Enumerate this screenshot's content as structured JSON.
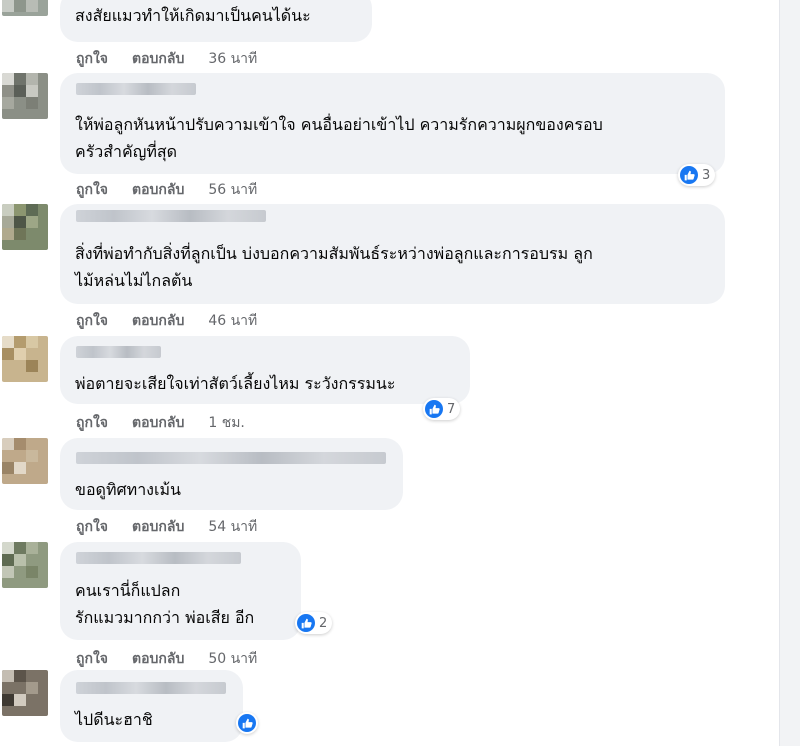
{
  "actions": {
    "like": "ถูกใจ",
    "reply": "ตอบกลับ"
  },
  "comments": [
    {
      "text": "สงสัยแมวทำให้เกิดมาเป็นคนได้นะ",
      "time": "36 นาที",
      "reactions": ""
    },
    {
      "name_partial": "",
      "text": "ให้พ่อลูกหันหน้าปรับความเข้าใจ คนอื่นอย่าเข้าไป ความรักความผูกของครอบ\nครัวสำคัญที่สุด",
      "time": "56 นาที",
      "reactions": "3"
    },
    {
      "text": "สิ่งที่พ่อทำกับสิ่งที่ลูกเป็น บ่งบอกความสัมพันธ์ระหว่างพ่อลูกและการอบรม ลูก\nไม้หล่นไม่ไกลต้น",
      "time": "46 นาที",
      "reactions": ""
    },
    {
      "text": "พ่อตายจะเสียใจเท่าสัตว์เลี้ยงไหม ระวังกรรมนะ",
      "time": "1 ชม.",
      "reactions": "7"
    },
    {
      "text": "ขอดูทิศทางเม้น",
      "time": "54 นาที",
      "reactions": ""
    },
    {
      "text": "คนเรานี่ก็แปลก\nรักแมวมากกว่า พ่อเสีย อีก",
      "time": "50 นาที",
      "reactions": "2"
    },
    {
      "text": "ไปดีนะฮาชิ",
      "time": "",
      "reactions": ""
    }
  ],
  "colors": {
    "bubble": "#f0f2f5",
    "like_blue": "#1877f2",
    "meta": "#65676b"
  }
}
